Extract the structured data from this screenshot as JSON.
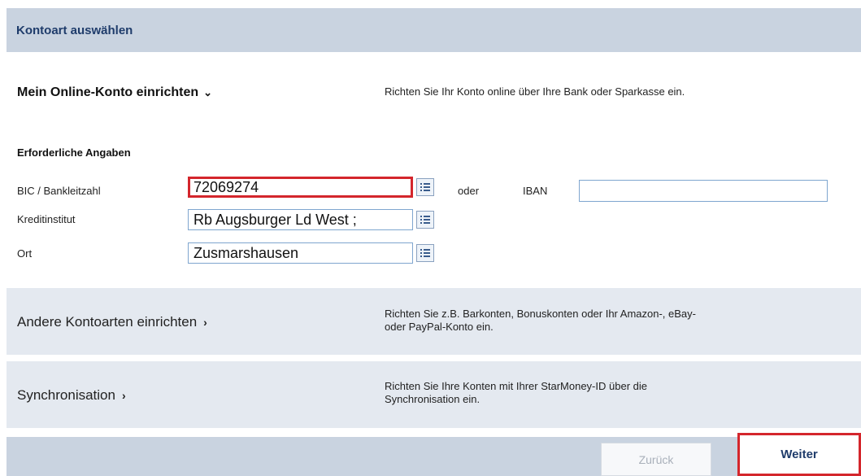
{
  "header": {
    "title": "Kontoart auswählen"
  },
  "online": {
    "title": "Mein Online-Konto einrichten",
    "chevron": "⌄",
    "description": "Richten Sie Ihr Konto online über Ihre Bank oder Sparkasse ein."
  },
  "form": {
    "heading": "Erforderliche Angaben",
    "bic_label": "BIC / Bankleitzahl",
    "bic_value": "72069274",
    "oder": "oder",
    "iban_label": "IBAN",
    "iban_value": "",
    "institute_label": "Kreditinstitut",
    "institute_value": "Rb Augsburger Ld West ;",
    "city_label": "Ort",
    "city_value": "Zusmarshausen",
    "list_icon": "list-icon"
  },
  "other": {
    "title": "Andere Kontoarten einrichten",
    "chevron": "›",
    "description_line1": "Richten Sie z.B. Barkonten, Bonuskonten oder Ihr Amazon-, eBay-",
    "description_line2": "oder PayPal-Konto ein."
  },
  "sync": {
    "title": "Synchronisation",
    "chevron": "›",
    "description_line1": "Richten Sie Ihre Konten mit Ihrer StarMoney-ID über die",
    "description_line2": "Synchronisation ein."
  },
  "footer": {
    "back_label": "Zurück",
    "next_label": "Weiter"
  },
  "colors": {
    "header_bg": "#c9d3e0",
    "band_bg": "#e4e9f0",
    "highlight": "#d4262c",
    "title_text": "#1f3c6b"
  }
}
